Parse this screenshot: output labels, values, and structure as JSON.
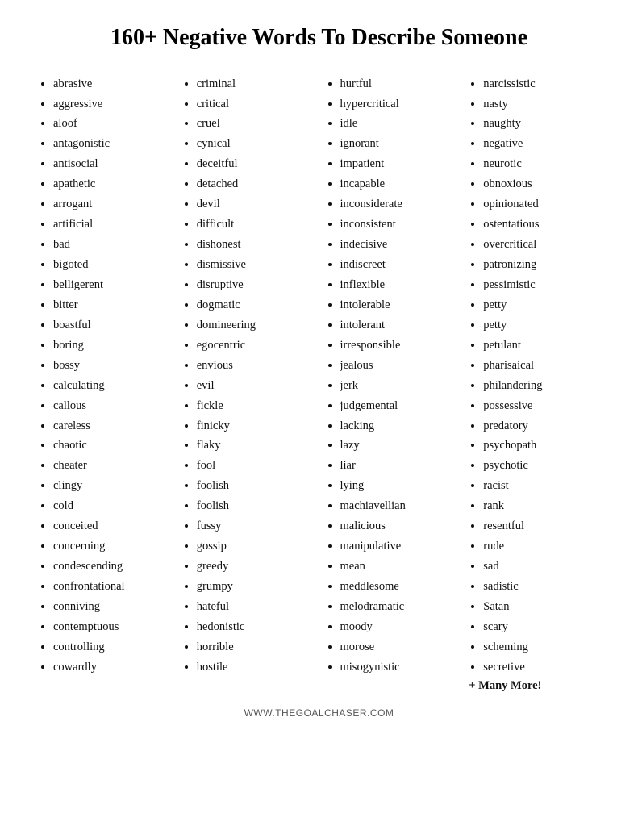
{
  "title": "160+ Negative Words To Describe Someone",
  "col1": [
    "abrasive",
    "aggressive",
    "aloof",
    "antagonistic",
    "antisocial",
    "apathetic",
    "arrogant",
    "artificial",
    "bad",
    "bigoted",
    "belligerent",
    "bitter",
    "boastful",
    "boring",
    "bossy",
    "calculating",
    "callous",
    "careless",
    "chaotic",
    "cheater",
    "clingy",
    "cold",
    "conceited",
    "concerning",
    "condescending",
    "confrontational",
    "conniving",
    "contemptuous",
    "controlling",
    "cowardly"
  ],
  "col2": [
    "criminal",
    "critical",
    "cruel",
    "cynical",
    "deceitful",
    "detached",
    "devil",
    "difficult",
    "dishonest",
    "dismissive",
    "disruptive",
    "dogmatic",
    "domineering",
    "egocentric",
    "envious",
    "evil",
    "fickle",
    "finicky",
    "flaky",
    "fool",
    "foolish",
    "foolish",
    "fussy",
    "gossip",
    "greedy",
    "grumpy",
    "hateful",
    "hedonistic",
    "horrible",
    "hostile"
  ],
  "col3": [
    "hurtful",
    "hypercritical",
    "idle",
    "ignorant",
    "impatient",
    "incapable",
    "inconsiderate",
    "inconsistent",
    "indecisive",
    "indiscreet",
    "inflexible",
    "intolerable",
    "intolerant",
    "irresponsible",
    "jealous",
    "jerk",
    "judgemental",
    "lacking",
    "lazy",
    "liar",
    "lying",
    "machiavellian",
    "malicious",
    "manipulative",
    "mean",
    "meddlesome",
    "melodramatic",
    "moody",
    "morose",
    "misogynistic"
  ],
  "col4": [
    "narcissistic",
    "nasty",
    "naughty",
    "negative",
    "neurotic",
    "obnoxious",
    "opinionated",
    "ostentatious",
    "overcritical",
    "patronizing",
    "pessimistic",
    "petty",
    "petty",
    "petulant",
    "pharisaical",
    "philandering",
    "possessive",
    "predatory",
    "psychopath",
    "psychotic",
    "racist",
    "rank",
    "resentful",
    "rude",
    "sad",
    "sadistic",
    "Satan",
    "scary",
    "scheming",
    "secretive"
  ],
  "more": "+ Many More!",
  "footer": "WWW.THEGOALCHASER.COM"
}
